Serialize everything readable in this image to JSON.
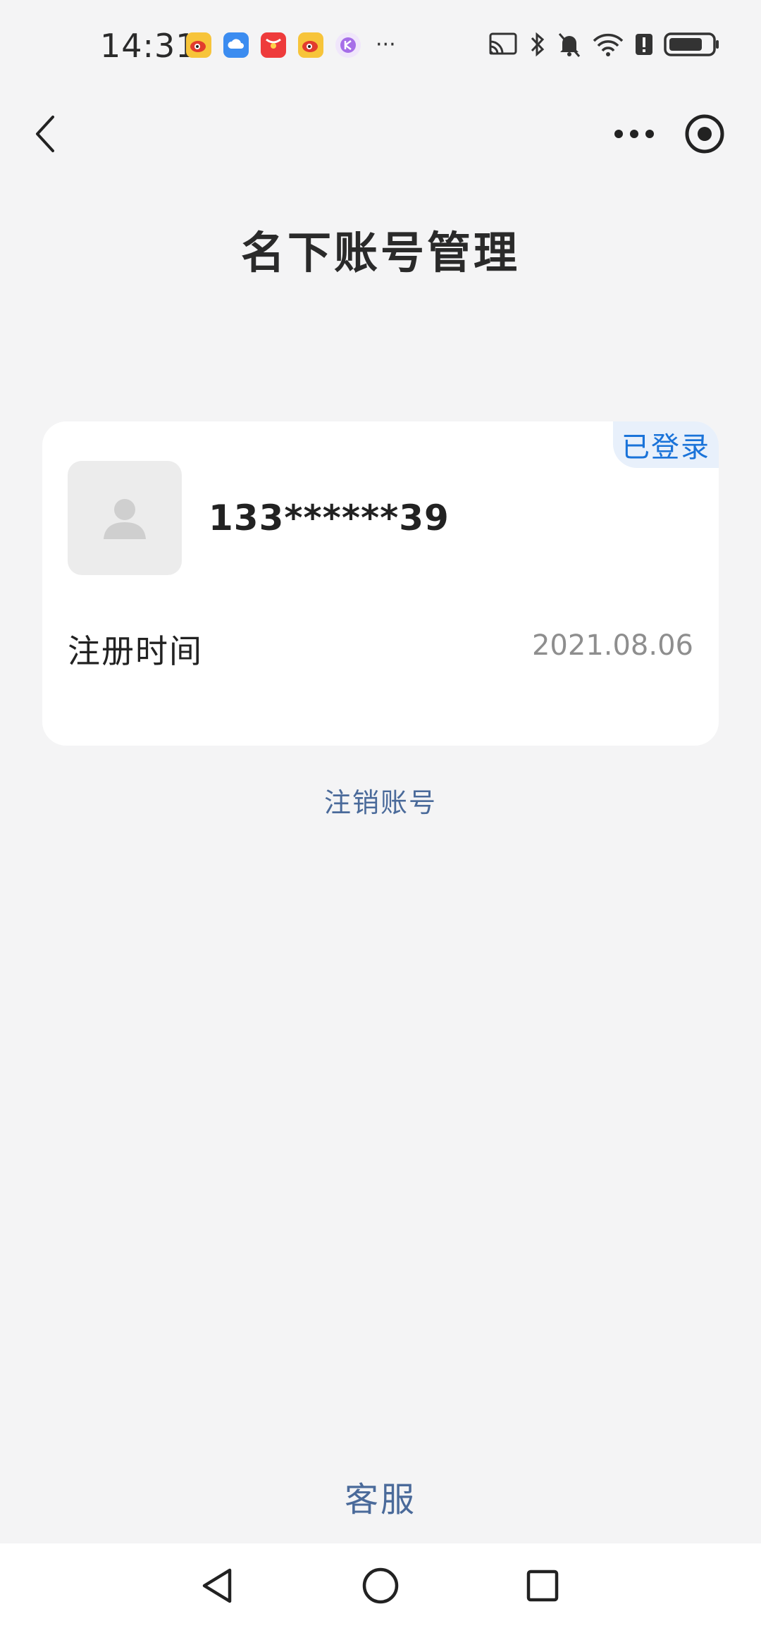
{
  "status_bar": {
    "time": "14:31",
    "more_notifications": "···",
    "notification_icons": [
      "weibo-icon",
      "cloud-icon",
      "red-packet-icon",
      "weibo-icon",
      "purple-app-icon"
    ],
    "system_icons": [
      "cast-icon",
      "bluetooth-icon",
      "mute-icon",
      "wifi-icon",
      "alert-icon",
      "battery-icon"
    ]
  },
  "nav": {
    "back_icon": "chevron-left-icon",
    "more_icon": "more-dots-icon",
    "close_icon": "target-circle-icon"
  },
  "page": {
    "title": "名下账号管理"
  },
  "account": {
    "badge": "已登录",
    "phone": "133******39",
    "registration_label": "注册时间",
    "registration_date": "2021.08.06"
  },
  "actions": {
    "cancel_account": "注销账号",
    "customer_service": "客服"
  },
  "colors": {
    "background": "#f4f4f5",
    "link": "#4a6a9a",
    "badge_text": "#1a73d9",
    "badge_bg": "#e8f0fb"
  }
}
